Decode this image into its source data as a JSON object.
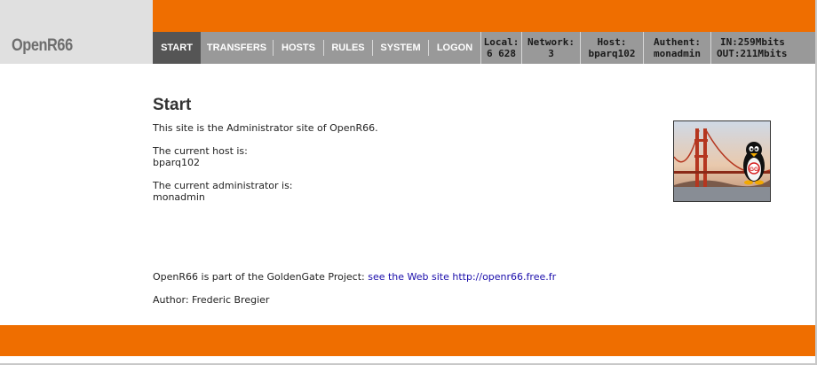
{
  "logo": {
    "text": "OpenR66"
  },
  "nav": {
    "items": [
      {
        "label": "START",
        "active": true
      },
      {
        "label": "TRANSFERS"
      },
      {
        "label": "HOSTS"
      },
      {
        "label": "RULES"
      },
      {
        "label": "SYSTEM"
      },
      {
        "label": "LOGON"
      }
    ]
  },
  "stats": {
    "local": {
      "label": "Local:",
      "value": "6 628"
    },
    "network": {
      "label": "Network:",
      "value": "3"
    },
    "host": {
      "label": "Host:",
      "value": "bparq102"
    },
    "authent": {
      "label": "Authent:",
      "value": "monadmin"
    },
    "bandwidth": {
      "in": "IN:259Mbits",
      "out": "OUT:211Mbits"
    }
  },
  "content": {
    "title": "Start",
    "intro": "This site is the Administrator site of OpenR66.",
    "host_label": "The current host is:",
    "host_value": "bparq102",
    "admin_label": "The current administrator is:",
    "admin_value": "monadmin",
    "project_text": "OpenR66 is part of the GoldenGate Project:",
    "project_link": "see the Web site http://openr66.free.fr",
    "author": "Author: Frederic Bregier"
  },
  "image": {
    "badge": "GG"
  },
  "colors": {
    "accent": "#ef6e00",
    "nav_bg": "#999999",
    "nav_active": "#555555"
  }
}
